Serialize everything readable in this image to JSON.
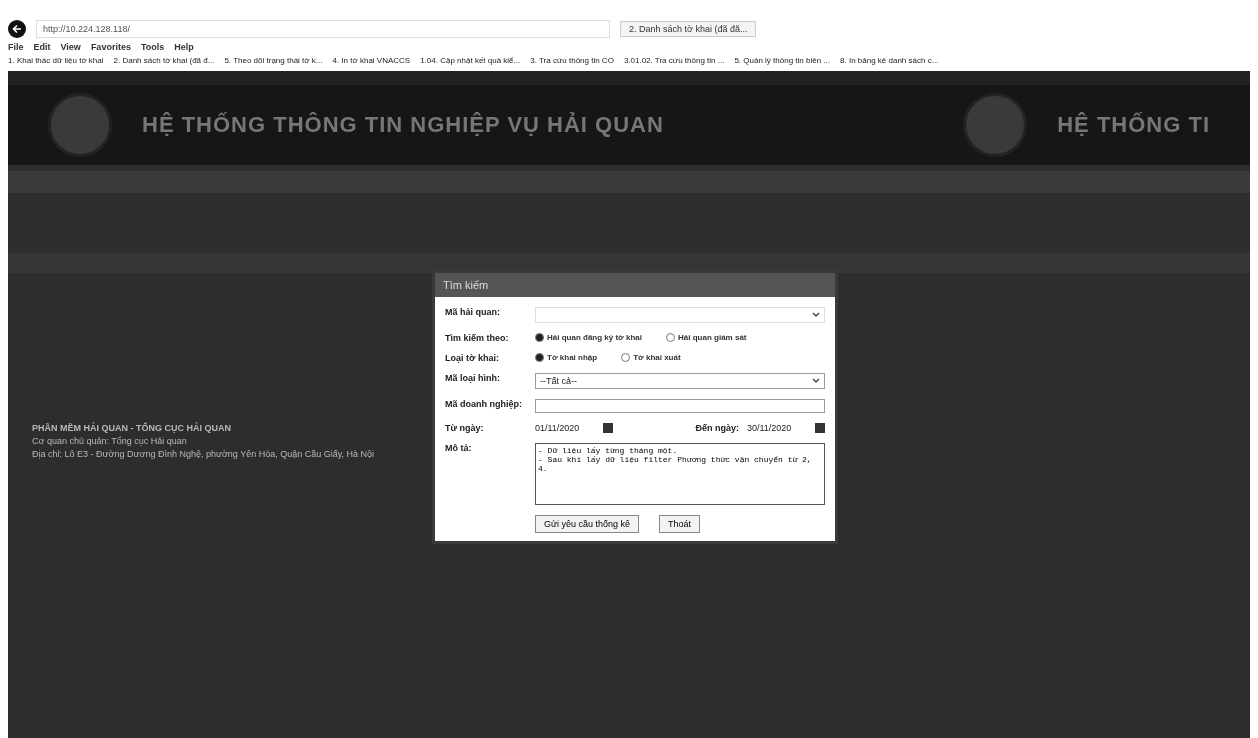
{
  "browser": {
    "address": "http://10.224.128.118/",
    "tab": "2. Danh sách tờ khai (đã đă...",
    "menu": [
      "File",
      "Edit",
      "View",
      "Favorites",
      "Tools",
      "Help"
    ],
    "favorites": [
      "1. Khai thác dữ liệu tờ khai",
      "2. Danh sách tờ khai (đã đ...",
      "5. Theo dõi trạng thái tờ k...",
      "4. In tờ khai VNACCS",
      "1.04. Cập nhật kết quả kiể...",
      "3. Tra cứu thông tin CO",
      "3.01.02. Tra cứu thông tin ...",
      "5. Quản lý thông tin biên ...",
      "8. In bảng kê danh sách c..."
    ]
  },
  "header": {
    "title": "HỆ THỐNG THÔNG TIN NGHIỆP VỤ HẢI QUAN",
    "title_right": "HỆ THỐNG TI"
  },
  "footer": [
    "PHẦN MỀM HẢI QUAN - TỔNG CỤC HẢI QUAN",
    "Cơ quan chủ quản: Tổng cục Hải quan",
    "Địa chỉ: Lô E3 - Đường Dương Đình Nghệ, phường Yên Hòa, Quận Cầu Giấy, Hà Nội"
  ],
  "dialog": {
    "title": "Tìm kiếm",
    "rows": [
      {
        "kind": "select",
        "label": "Mã hải quan:",
        "value": "",
        "disabled": true
      },
      {
        "kind": "radio",
        "label": "Tìm kiếm theo:",
        "options": [
          {
            "label": "Hải quan đăng ký tờ khai",
            "selected": true
          },
          {
            "label": "Hải quan giám sát",
            "selected": false
          }
        ]
      },
      {
        "kind": "radio",
        "label": "Loại tờ khai:",
        "options": [
          {
            "label": "Tờ khai nhập",
            "selected": true
          },
          {
            "label": "Tờ khai xuất",
            "selected": false
          }
        ]
      },
      {
        "kind": "select",
        "label": "Mã loại hình:",
        "value": "--Tất cả--",
        "disabled": false
      },
      {
        "kind": "text",
        "label": "Mã doanh nghiệp:",
        "value": ""
      },
      {
        "kind": "dates",
        "label": "Từ ngày:",
        "value": "01/11/2020",
        "label2": "Đến ngày:",
        "value2": "30/11/2020"
      },
      {
        "kind": "textarea",
        "label": "Mô tả:",
        "value": "- Dữ liệu lấy từng tháng một.\n- Sau khi lấy dữ liệu filter Phương thức vận chuyển từ 2, 4."
      }
    ],
    "buttons": [
      "Gửi yêu cầu thống kê",
      "Thoát"
    ]
  }
}
